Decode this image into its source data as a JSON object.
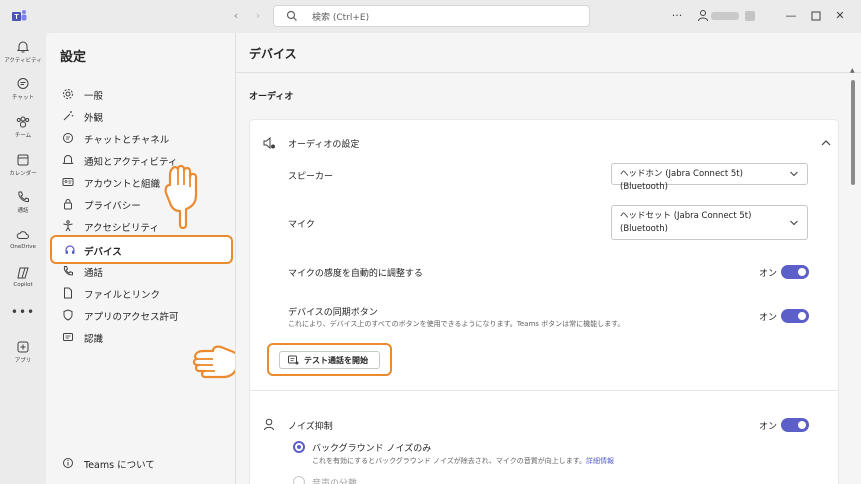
{
  "titlebar": {
    "search_placeholder": "検索 (Ctrl+E)"
  },
  "rail": {
    "items": [
      {
        "label": "アクティビティ",
        "icon": "bell-icon"
      },
      {
        "label": "チャット",
        "icon": "chat-icon"
      },
      {
        "label": "チーム",
        "icon": "teams-icon"
      },
      {
        "label": "カレンダー",
        "icon": "calendar-icon"
      },
      {
        "label": "通話",
        "icon": "phone-icon"
      },
      {
        "label": "OneDrive",
        "icon": "cloud-icon"
      },
      {
        "label": "Copilot",
        "icon": "copilot-icon"
      },
      {
        "label": "アプリ",
        "icon": "add-app-icon"
      }
    ],
    "more": "•••"
  },
  "settings": {
    "title": "設定",
    "items": [
      {
        "label": "一般",
        "icon": "gear-icon"
      },
      {
        "label": "外観",
        "icon": "wand-icon"
      },
      {
        "label": "チャットとチャネル",
        "icon": "chat-icon"
      },
      {
        "label": "通知とアクティビティ",
        "icon": "bell-icon"
      },
      {
        "label": "アカウントと組織",
        "icon": "id-card-icon"
      },
      {
        "label": "プライバシー",
        "icon": "lock-icon"
      },
      {
        "label": "アクセシビリティ",
        "icon": "accessibility-icon"
      },
      {
        "label": "デバイス",
        "icon": "headset-icon"
      },
      {
        "label": "通話",
        "icon": "phone-icon"
      },
      {
        "label": "ファイルとリンク",
        "icon": "document-icon"
      },
      {
        "label": "アプリのアクセス許可",
        "icon": "shield-icon"
      },
      {
        "label": "認識",
        "icon": "recognition-icon"
      }
    ],
    "selected_index": 7,
    "about": "Teams について"
  },
  "main": {
    "title": "デバイス",
    "section": "オーディオ",
    "audio_settings_title": "オーディオの設定",
    "speaker_label": "スピーカー",
    "speaker_value": "ヘッドホン (Jabra Connect 5t) (Bluetooth)",
    "mic_label": "マイク",
    "mic_value_line1": "ヘッドセット (Jabra Connect 5t)",
    "mic_value_line2": "(Bluetooth)",
    "auto_adjust_label": "マイクの感度を自動的に調整する",
    "auto_adjust_state": "オン",
    "sync_label": "デバイスの同期ボタン",
    "sync_desc": "これにより、デバイス上のすべてのボタンを使用できるようになります。Teams ボタンは常に機能します。",
    "sync_state": "オン",
    "test_call_button": "テスト通話を開始",
    "noise_label": "ノイズ抑制",
    "noise_state": "オン",
    "bg_noise_label": "バックグラウンド ノイズのみ",
    "bg_noise_desc": "これを有効にするとバックグラウンド ノイズが除去され、マイクの音質が向上します。",
    "details_link": "詳細情報",
    "voice_isolation_label": "音声の分離"
  },
  "colors": {
    "accent": "#5b5fc7",
    "highlight": "#ec8a2f"
  }
}
